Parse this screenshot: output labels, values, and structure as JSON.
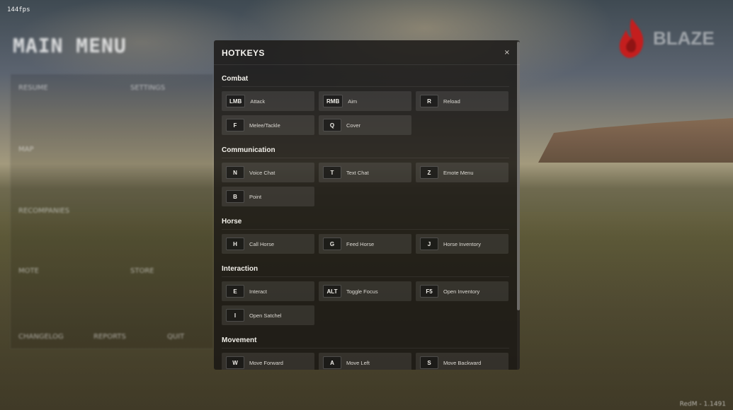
{
  "fps": "144fps",
  "background": {
    "main_menu_title": "MAIN MENU",
    "menu_items": [
      "RESUME",
      "SETTINGS",
      "MAP",
      "RECOMPANIES",
      "MOTE",
      "STORE",
      "CHANGELOG",
      "REPORTS",
      "QUIT"
    ],
    "brand": "BLAZE",
    "version": "RedM - 1.1491"
  },
  "colors": {
    "modal_bg": "#181614",
    "key_bg": "#0a0a0a",
    "tile_bg": "#2e2c29",
    "brand_red": "#c41e1e"
  },
  "modal": {
    "title": "HOTKEYS",
    "close_label": "×",
    "close_icon": "close-icon",
    "sections": [
      {
        "title": "Combat",
        "hotkeys": [
          {
            "key": "LMB",
            "action": "Attack"
          },
          {
            "key": "RMB",
            "action": "Aim"
          },
          {
            "key": "R",
            "action": "Reload"
          },
          {
            "key": "F",
            "action": "Melee/Tackle"
          },
          {
            "key": "Q",
            "action": "Cover"
          }
        ]
      },
      {
        "title": "Communication",
        "hotkeys": [
          {
            "key": "N",
            "action": "Voice Chat"
          },
          {
            "key": "T",
            "action": "Text Chat"
          },
          {
            "key": "Z",
            "action": "Emote Menu"
          },
          {
            "key": "B",
            "action": "Point"
          }
        ]
      },
      {
        "title": "Horse",
        "hotkeys": [
          {
            "key": "H",
            "action": "Call Horse"
          },
          {
            "key": "G",
            "action": "Feed Horse"
          },
          {
            "key": "J",
            "action": "Horse Inventory"
          }
        ]
      },
      {
        "title": "Interaction",
        "hotkeys": [
          {
            "key": "E",
            "action": "Interact"
          },
          {
            "key": "ALT",
            "action": "Toggle Focus"
          },
          {
            "key": "F5",
            "action": "Open Inventory"
          },
          {
            "key": "I",
            "action": "Open Satchel"
          }
        ]
      },
      {
        "title": "Movement",
        "hotkeys": [
          {
            "key": "W",
            "action": "Move Forward"
          },
          {
            "key": "A",
            "action": "Move Left"
          },
          {
            "key": "S",
            "action": "Move Backward"
          }
        ]
      }
    ]
  }
}
